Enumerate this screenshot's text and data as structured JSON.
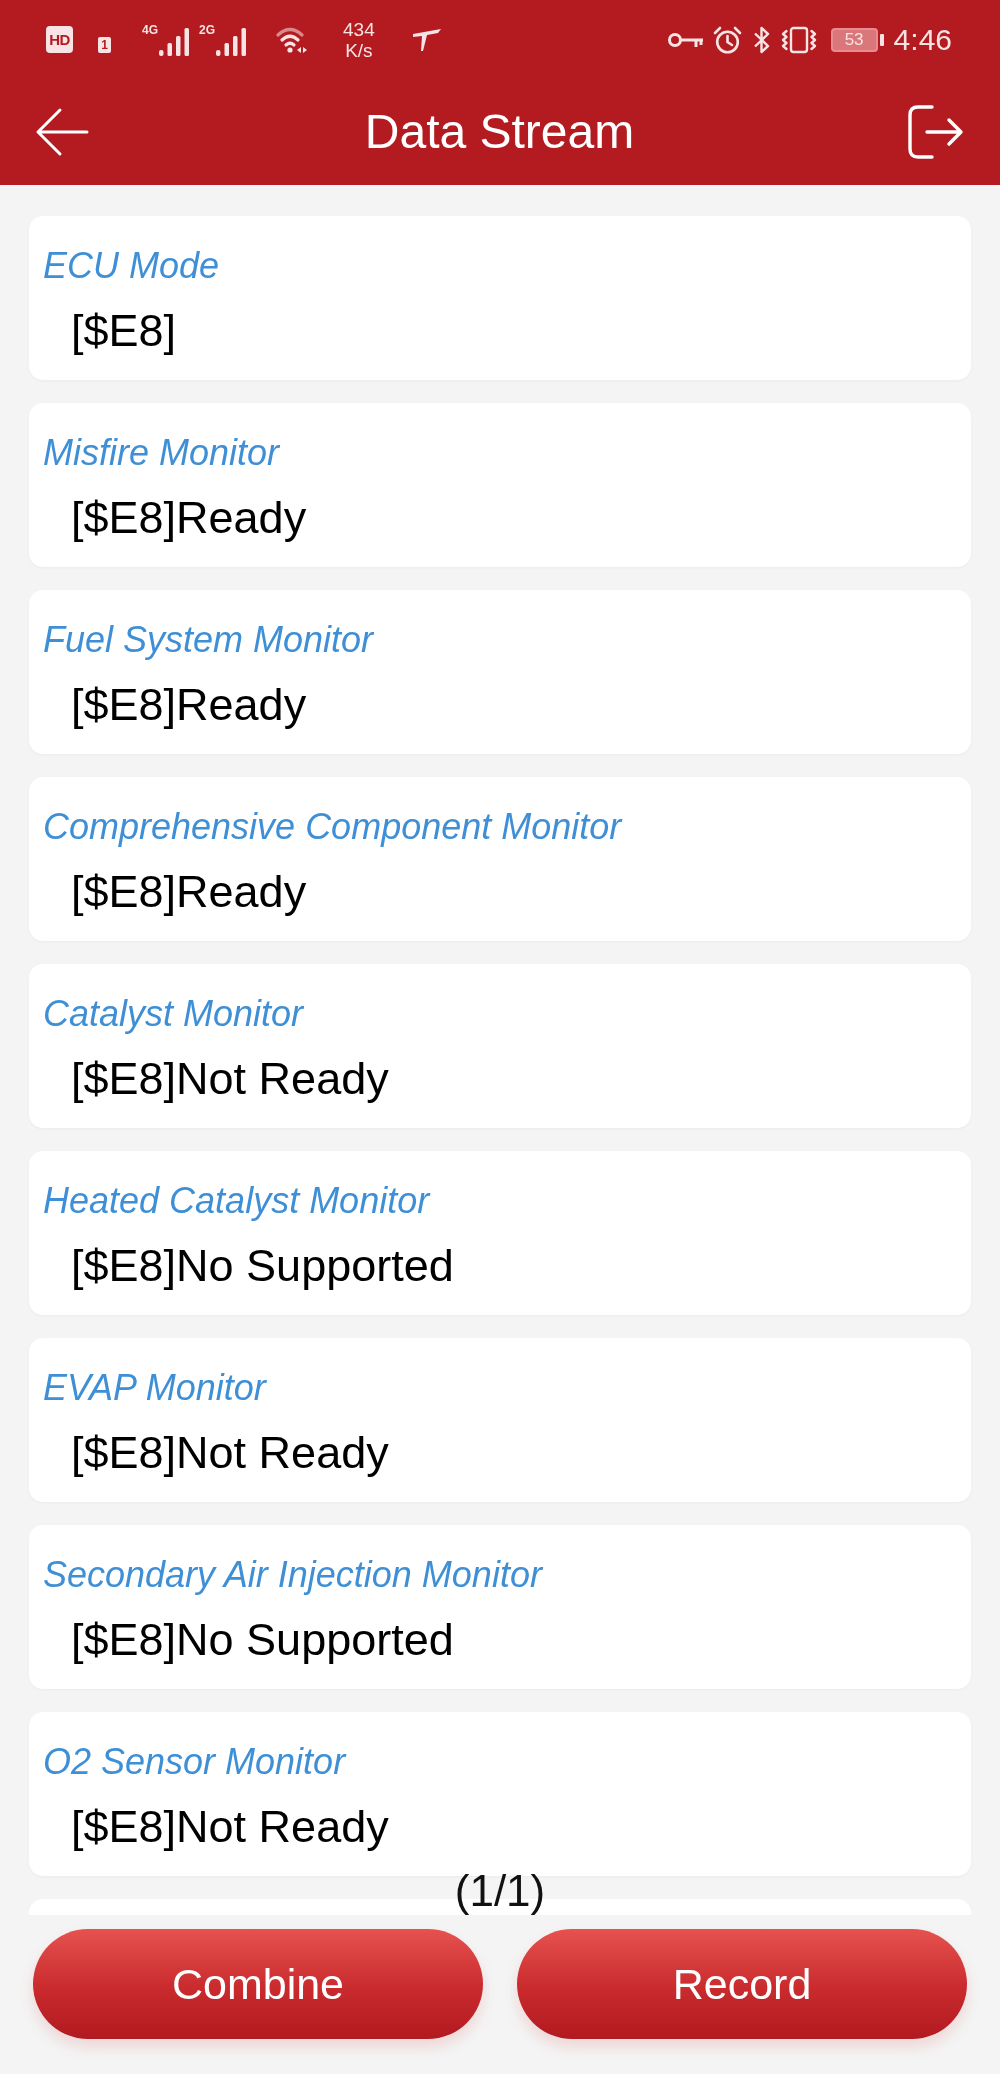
{
  "status_bar": {
    "hd": "HD",
    "sim_slot": "1",
    "networks": [
      {
        "label": "4G"
      },
      {
        "label": "2G"
      }
    ],
    "speed": {
      "value": "434",
      "unit": "K/s"
    },
    "battery": "53",
    "time": "4:46"
  },
  "header": {
    "title": "Data Stream"
  },
  "items": [
    {
      "label": "ECU Mode",
      "value": "[$E8]"
    },
    {
      "label": "Misfire Monitor",
      "value": "[$E8]Ready"
    },
    {
      "label": "Fuel System Monitor",
      "value": "[$E8]Ready"
    },
    {
      "label": "Comprehensive Component Monitor",
      "value": "[$E8]Ready"
    },
    {
      "label": "Catalyst Monitor",
      "value": "[$E8]Not Ready"
    },
    {
      "label": "Heated Catalyst Monitor",
      "value": "[$E8]No Supported"
    },
    {
      "label": "EVAP Monitor",
      "value": "[$E8]Not Ready"
    },
    {
      "label": "Secondary Air Injection Monitor",
      "value": "[$E8]No Supported"
    },
    {
      "label": "O2 Sensor Monitor",
      "value": "[$E8]Not Ready"
    }
  ],
  "list_continues": true,
  "pager": "(1/1)",
  "buttons": [
    {
      "label": "Combine"
    },
    {
      "label": "Record"
    }
  ]
}
